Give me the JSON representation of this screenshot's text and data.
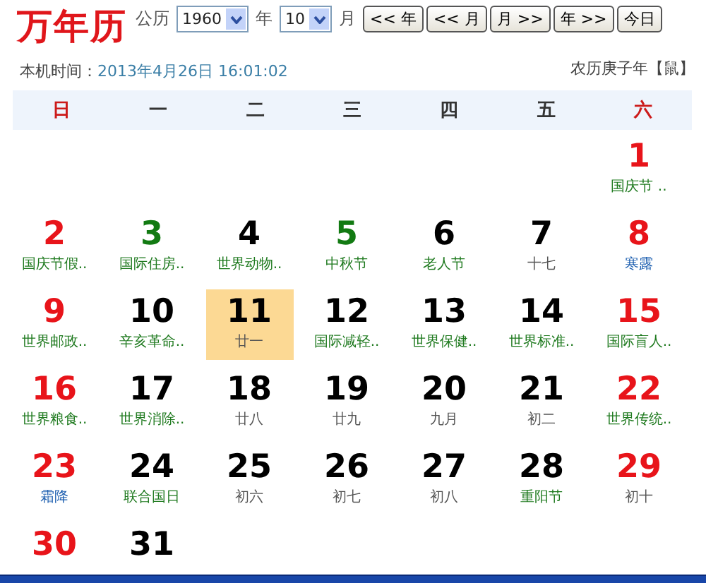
{
  "title": "万年历",
  "controls": {
    "calendar_label": "公历",
    "year": "1960",
    "year_unit": "年",
    "month": "10",
    "month_unit": "月",
    "buttons": [
      "<< 年",
      "<< 月",
      "月 >>",
      "年 >>",
      "今日"
    ]
  },
  "clock": {
    "label": "本机时间：",
    "value": "2013年4月26日 16:01:02"
  },
  "lunar_year": "农历庚子年【鼠】",
  "weekdays": [
    {
      "label": "日",
      "weekend": true
    },
    {
      "label": "一",
      "weekend": false
    },
    {
      "label": "二",
      "weekend": false
    },
    {
      "label": "三",
      "weekend": false
    },
    {
      "label": "四",
      "weekend": false
    },
    {
      "label": "五",
      "weekend": false
    },
    {
      "label": "六",
      "weekend": true
    }
  ],
  "days": [
    {
      "kind": "blank"
    },
    {
      "kind": "blank"
    },
    {
      "kind": "blank"
    },
    {
      "kind": "blank"
    },
    {
      "kind": "blank"
    },
    {
      "kind": "blank"
    },
    {
      "number": "1",
      "kind": "holiday",
      "note": {
        "text": "国庆节 ..",
        "kind": "festival"
      },
      "selected": false
    },
    {
      "number": "2",
      "kind": "holiday",
      "note": {
        "text": "国庆节假..",
        "kind": "festival"
      },
      "selected": false
    },
    {
      "number": "3",
      "kind": "festival",
      "note": {
        "text": "国际住房..",
        "kind": "festival"
      },
      "selected": false
    },
    {
      "number": "4",
      "kind": "plain",
      "note": {
        "text": "世界动物..",
        "kind": "festival"
      },
      "selected": false
    },
    {
      "number": "5",
      "kind": "festival",
      "note": {
        "text": "中秋节",
        "kind": "festival"
      },
      "selected": false
    },
    {
      "number": "6",
      "kind": "plain",
      "note": {
        "text": "老人节",
        "kind": "festival"
      },
      "selected": false
    },
    {
      "number": "7",
      "kind": "plain",
      "note": {
        "text": "十七",
        "kind": "lunar"
      },
      "selected": false
    },
    {
      "number": "8",
      "kind": "holiday",
      "note": {
        "text": "寒露",
        "kind": "solar_term"
      },
      "selected": false
    },
    {
      "number": "9",
      "kind": "holiday",
      "note": {
        "text": "世界邮政..",
        "kind": "festival"
      },
      "selected": false
    },
    {
      "number": "10",
      "kind": "plain",
      "note": {
        "text": "辛亥革命..",
        "kind": "festival"
      },
      "selected": false
    },
    {
      "number": "11",
      "kind": "plain",
      "note": {
        "text": "廿一",
        "kind": "lunar"
      },
      "selected": true
    },
    {
      "number": "12",
      "kind": "plain",
      "note": {
        "text": "国际减轻..",
        "kind": "festival"
      },
      "selected": false
    },
    {
      "number": "13",
      "kind": "plain",
      "note": {
        "text": "世界保健..",
        "kind": "festival"
      },
      "selected": false
    },
    {
      "number": "14",
      "kind": "plain",
      "note": {
        "text": "世界标准..",
        "kind": "festival"
      },
      "selected": false
    },
    {
      "number": "15",
      "kind": "holiday",
      "note": {
        "text": "国际盲人..",
        "kind": "festival"
      },
      "selected": false
    },
    {
      "number": "16",
      "kind": "holiday",
      "note": {
        "text": "世界粮食..",
        "kind": "festival"
      },
      "selected": false
    },
    {
      "number": "17",
      "kind": "plain",
      "note": {
        "text": "世界消除..",
        "kind": "festival"
      },
      "selected": false
    },
    {
      "number": "18",
      "kind": "plain",
      "note": {
        "text": "廿八",
        "kind": "lunar"
      },
      "selected": false
    },
    {
      "number": "19",
      "kind": "plain",
      "note": {
        "text": "廿九",
        "kind": "lunar"
      },
      "selected": false
    },
    {
      "number": "20",
      "kind": "plain",
      "note": {
        "text": "九月",
        "kind": "lunar"
      },
      "selected": false
    },
    {
      "number": "21",
      "kind": "plain",
      "note": {
        "text": "初二",
        "kind": "lunar"
      },
      "selected": false
    },
    {
      "number": "22",
      "kind": "holiday",
      "note": {
        "text": "世界传统..",
        "kind": "festival"
      },
      "selected": false
    },
    {
      "number": "23",
      "kind": "holiday",
      "note": {
        "text": "霜降",
        "kind": "solar_term"
      },
      "selected": false
    },
    {
      "number": "24",
      "kind": "plain",
      "note": {
        "text": "联合国日",
        "kind": "festival"
      },
      "selected": false
    },
    {
      "number": "25",
      "kind": "plain",
      "note": {
        "text": "初六",
        "kind": "lunar"
      },
      "selected": false
    },
    {
      "number": "26",
      "kind": "plain",
      "note": {
        "text": "初七",
        "kind": "lunar"
      },
      "selected": false
    },
    {
      "number": "27",
      "kind": "plain",
      "note": {
        "text": "初八",
        "kind": "lunar"
      },
      "selected": false
    },
    {
      "number": "28",
      "kind": "plain",
      "note": {
        "text": "重阳节",
        "kind": "festival"
      },
      "selected": false
    },
    {
      "number": "29",
      "kind": "holiday",
      "note": {
        "text": "初十",
        "kind": "lunar"
      },
      "selected": false
    },
    {
      "number": "30",
      "kind": "holiday",
      "selected": false
    },
    {
      "number": "31",
      "kind": "plain",
      "selected": false
    }
  ]
}
